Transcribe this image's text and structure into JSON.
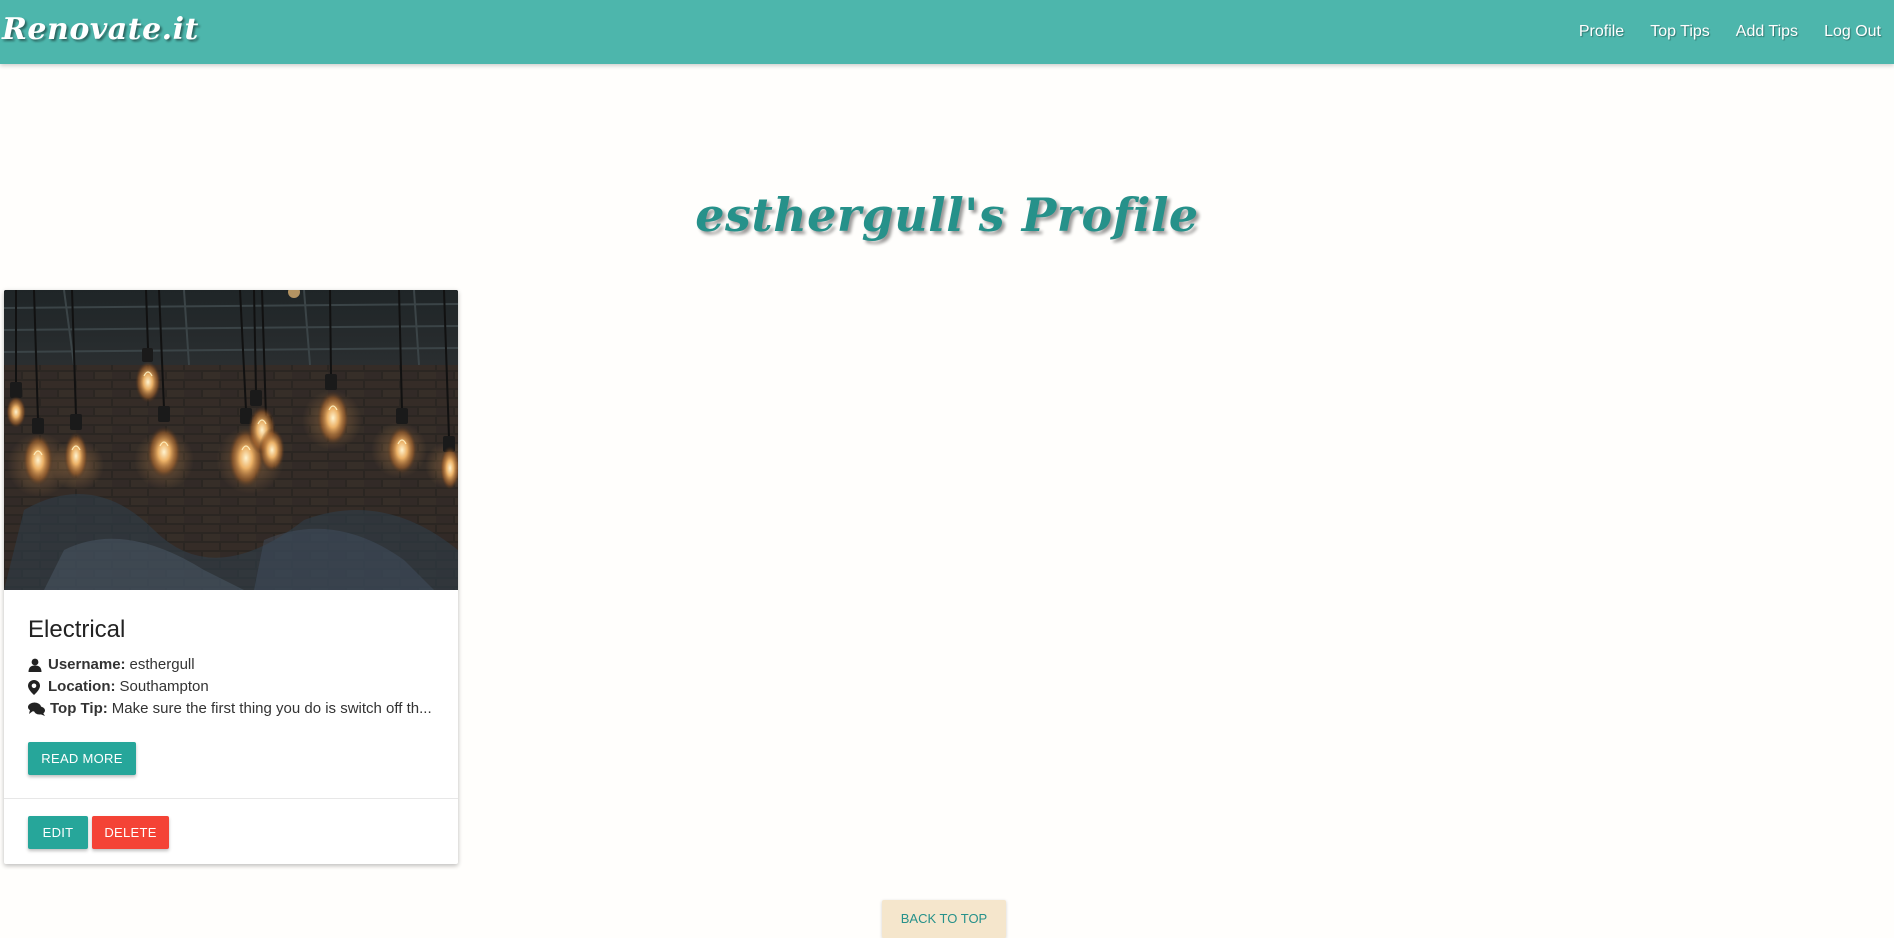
{
  "navbar": {
    "brand": "Renovate.it",
    "links": [
      "Profile",
      "Top Tips",
      "Add Tips",
      "Log Out"
    ]
  },
  "page": {
    "title": "esthergull's Profile"
  },
  "card": {
    "image_icon": "edison-light-bulbs-photo",
    "title": "Electrical",
    "username_label": "Username:",
    "username": "esthergull",
    "location_label": "Location:",
    "location": "Southampton",
    "tip_label": "Top Tip:",
    "tip": "Make sure the first thing you do is switch off th...",
    "read_more": "Read More",
    "edit": "Edit",
    "delete": "Delete"
  },
  "footer": {
    "back_to_top": "Back to Top"
  },
  "colors": {
    "navbar": "#4db6ac",
    "title": "#26918a",
    "button_teal": "#26a69a",
    "button_red": "#f44336",
    "back_to_top_bg": "#f5e6cc"
  }
}
